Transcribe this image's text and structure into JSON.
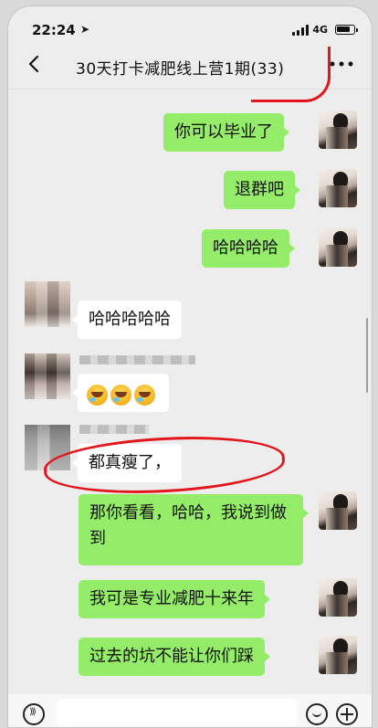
{
  "status_bar": {
    "time": "22:24",
    "network": "4G"
  },
  "header": {
    "title": "30天打卡减肥线上营1期(33)"
  },
  "messages": [
    {
      "side": "out",
      "text": "你可以毕业了"
    },
    {
      "side": "out",
      "text": "退群吧"
    },
    {
      "side": "out",
      "text": "哈哈哈哈"
    },
    {
      "side": "in",
      "text": "哈哈哈哈哈"
    },
    {
      "side": "in",
      "emoji": "laughing-crying-face",
      "emoji_count": 3
    },
    {
      "side": "in",
      "text": "都真瘦了，"
    },
    {
      "side": "out",
      "text": "那你看看，哈哈，我说到做到"
    },
    {
      "side": "out",
      "text": "我可是专业减肥十来年"
    },
    {
      "side": "out",
      "text": "过去的坑不能让你们踩"
    }
  ],
  "colors": {
    "outgoing_bubble": "#95ec69",
    "incoming_bubble": "#ffffff",
    "background": "#ededed",
    "annotation_red": "#e3151a"
  }
}
